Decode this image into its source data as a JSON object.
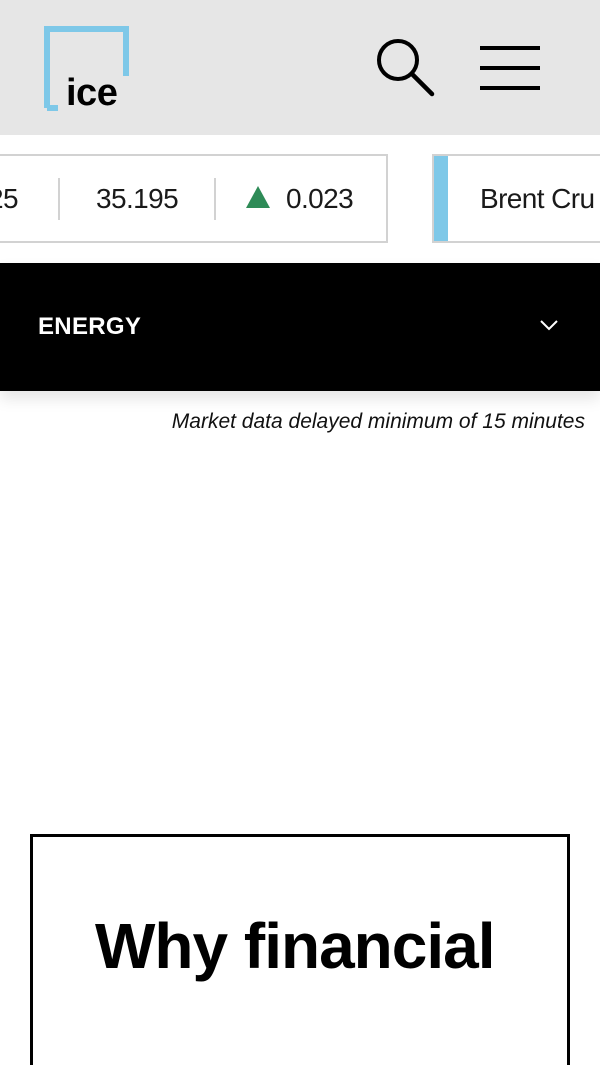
{
  "header": {
    "logo_text": "ice",
    "logo_color": "#7ec8e8",
    "search_icon": "search-icon",
    "menu_icon": "hamburger-menu-icon"
  },
  "ticker": {
    "card1": {
      "partial_value": "25",
      "value": "35.195",
      "change_direction": "up",
      "change_color": "#2e8b57",
      "change": "0.023"
    },
    "card2": {
      "name": "Brent Cru",
      "accent_color": "#7ec8e8"
    }
  },
  "market_selector": {
    "label": "ENERGY",
    "icon": "chevron-down-icon"
  },
  "delay_note": "Market data delayed minimum of 15 minutes",
  "promo": {
    "title": "Why financial"
  }
}
